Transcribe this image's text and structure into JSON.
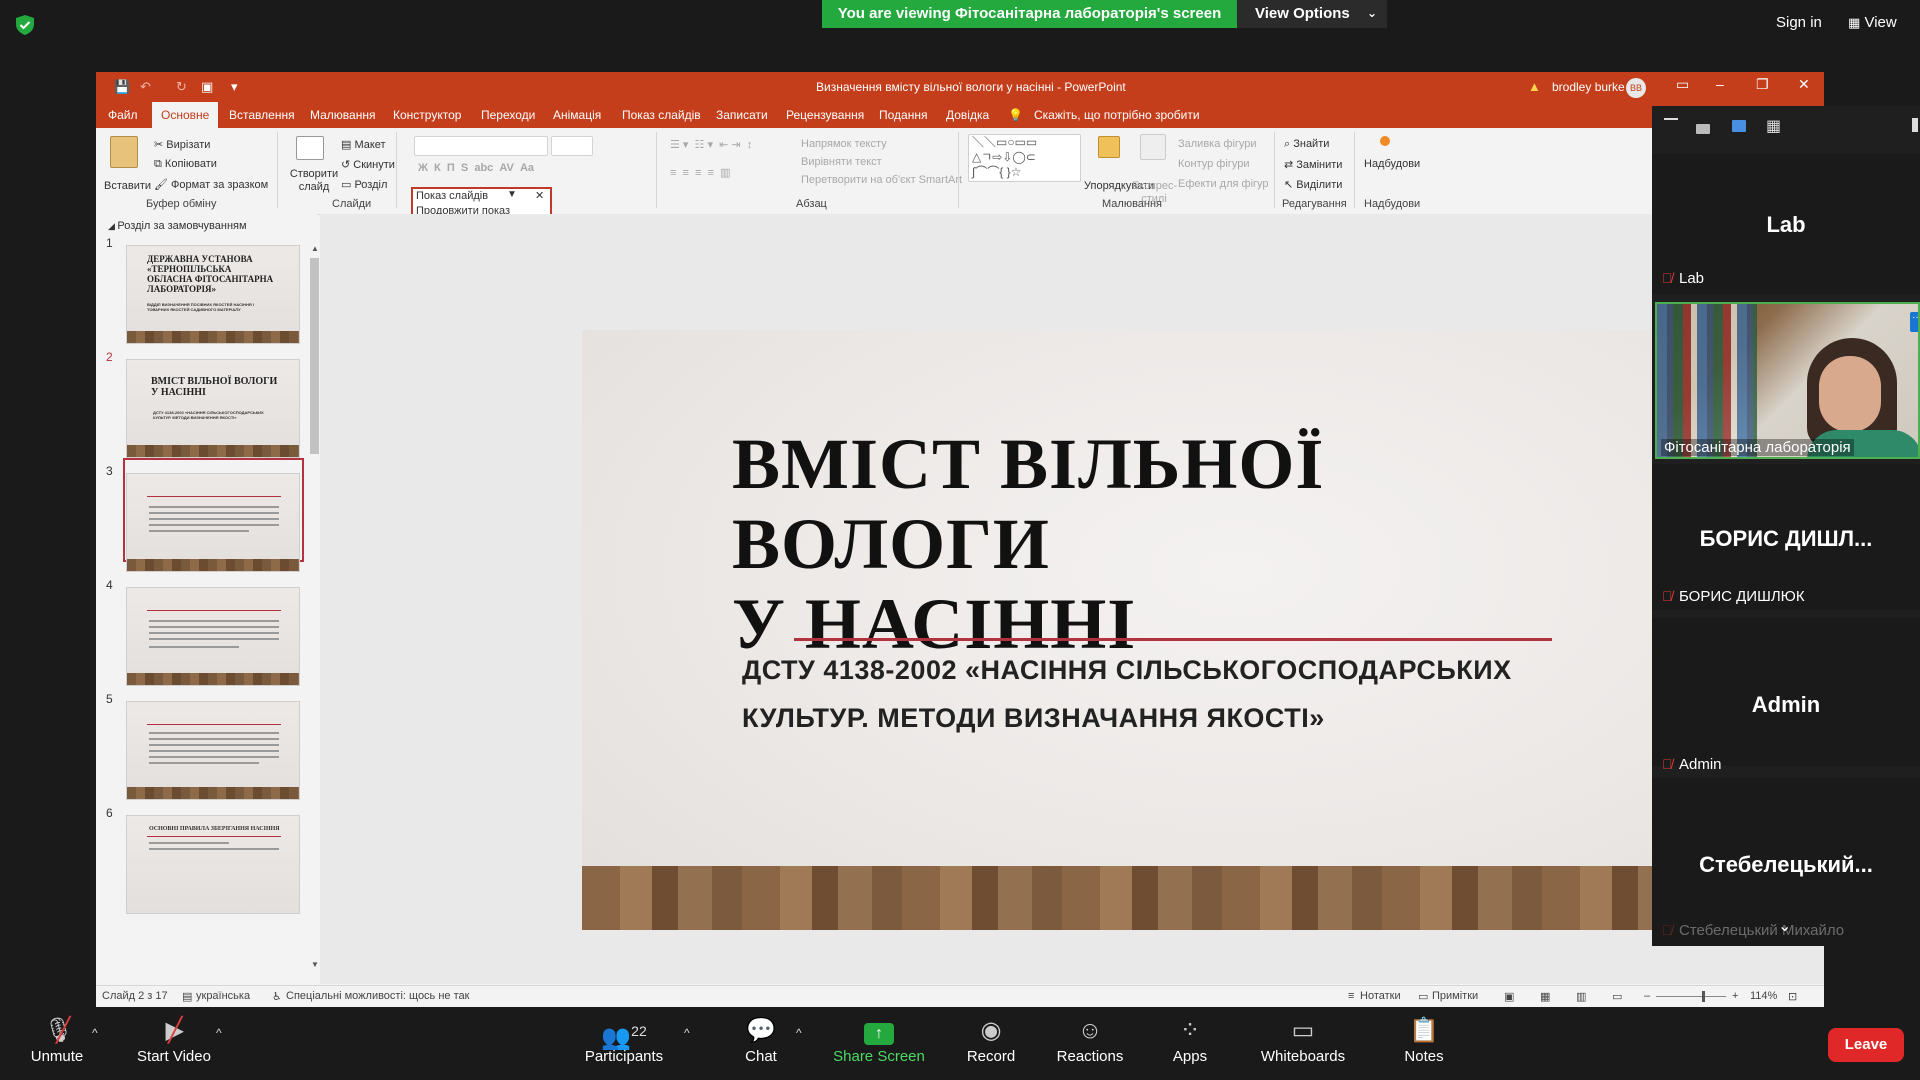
{
  "zoom_top": {
    "banner": "You are viewing Фітосанітарна лабораторія's screen",
    "view_options": "View Options",
    "sign_in": "Sign in",
    "view": "View"
  },
  "ppt": {
    "window_title": "Визначення вмісту вільної вологи у насінні  -  PowerPoint",
    "user_name": "brodley burke",
    "user_initials": "BB",
    "tabs": [
      "Файл",
      "Основне",
      "Вставлення",
      "Малювання",
      "Конструктор",
      "Переходи",
      "Анімація",
      "Показ слайдів",
      "Записати",
      "Рецензування",
      "Подання",
      "Довідка"
    ],
    "tell_me": "Скажіть, що потрібно зробити",
    "ribbon": {
      "paste": "Вставити",
      "cut": "Вирізати",
      "copy": "Копіювати",
      "format_painter": "Формат за зразком",
      "clipboard_group": "Буфер обміну",
      "new_slide": "Створити слайд",
      "layout": "Макет",
      "reset": "Скинути",
      "section": "Розділ",
      "slides_group": "Слайди",
      "text_direction": "Напрямок тексту",
      "align_text": "Вирівняти текст",
      "smartart": "Перетворити на об'єкт SmartArt",
      "paragraph_group": "Абзац",
      "arrange": "Упорядкувати",
      "quick_styles": "Експрес-стилі",
      "shape_fill": "Заливка фігури",
      "shape_outline": "Контур фігури",
      "shape_effects": "Ефекти для фігур",
      "drawing_group": "Малювання",
      "find": "Знайти",
      "replace": "Замінити",
      "select": "Виділити",
      "editing_group": "Редагування",
      "addins": "Надбудови",
      "addins_group": "Надбудови"
    },
    "slideshow_popup": {
      "item1": "Показ слайдів",
      "item2": "Продовжити показ слайдів"
    },
    "section_header": "Розділ за замовчуванням",
    "thumbnails": [
      {
        "num": "1",
        "title": "ДЕРЖАВНА УСТАНОВА «ТЕРНОПІЛЬСЬКА ОБЛАСНА ФІТОСАНІТАРНА ЛАБОРАТОРІЯ»",
        "sub": "ВІДДІЛ ВИЗНАЧЕННЯ ПОСІВНИХ ЯКОСТЕЙ НАСІННЯ І ТОВАРНИХ ЯКОСТЕЙ САДИВНОГО МАТЕРІАЛУ"
      },
      {
        "num": "2",
        "title": "ВМІСТ ВІЛЬНОЇ ВОЛОГИ У НАСІННІ",
        "sub": "ДСТУ 4138-2002 «НАСІННЯ СІЛЬСЬКОГОСПОДАРСЬКИХ КУЛЬТУР. МЕТОДИ ВИЗНАЧЕННЯ ЯКОСТІ»"
      },
      {
        "num": "3"
      },
      {
        "num": "4"
      },
      {
        "num": "5"
      },
      {
        "num": "6",
        "title": "ОСНОВНІ ПРАВИЛА ЗБЕРІГАННЯ НАСІННЯ"
      }
    ],
    "slide": {
      "title_line1": "ВМІСТ ВІЛЬНОЇ ВОЛОГИ",
      "title_line2": "У НАСІННІ",
      "subtitle_line1": "ДСТУ 4138-2002 «НАСІННЯ СІЛЬСЬКОГОСПОДАРСЬКИХ",
      "subtitle_line2": "КУЛЬТУР. МЕТОДИ ВИЗНАЧАННЯ ЯКОСТІ»"
    },
    "status": {
      "slide_counter": "Слайд 2 з 17",
      "language": "українська",
      "accessibility": "Спеціальні можливості: щось не так",
      "notes": "Нотатки",
      "comments": "Примітки",
      "zoom": "114%"
    }
  },
  "participants_panel": {
    "tiles": [
      {
        "big": "Lab",
        "name": "Lab"
      },
      {
        "name": "Фітосанітарна лабораторія"
      },
      {
        "big": "БОРИС  ДИШЛ...",
        "name": "БОРИС ДИШЛЮК"
      },
      {
        "big": "Admin",
        "name": "Admin"
      },
      {
        "big": "Стебелецький...",
        "name": "Стебелецький Михайло"
      }
    ]
  },
  "toolbar": {
    "unmute": "Unmute",
    "start_video": "Start Video",
    "participants": "Participants",
    "participants_count": "22",
    "chat": "Chat",
    "share_screen": "Share Screen",
    "record": "Record",
    "reactions": "Reactions",
    "apps": "Apps",
    "whiteboards": "Whiteboards",
    "notes": "Notes",
    "leave": "Leave"
  },
  "colors": {
    "ppt_accent": "#c43e1c",
    "banner_green": "#23a93e",
    "leave_red": "#e02828",
    "slide_rule": "#b3323f"
  }
}
